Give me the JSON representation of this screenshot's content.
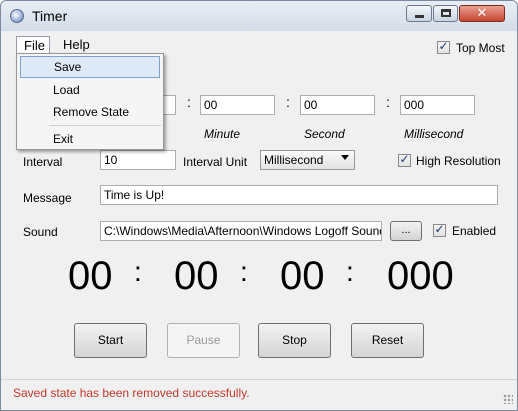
{
  "window": {
    "title": "Timer"
  },
  "menu": {
    "file": "File",
    "help": "Help",
    "file_items": [
      "Save",
      "Load",
      "Remove State",
      "Exit"
    ]
  },
  "top_most": {
    "label": "Top Most",
    "checked": true
  },
  "time_fields": {
    "minute_value": "00",
    "second_value": "00",
    "millisecond_value": "000",
    "minute_label": "Minute",
    "second_label": "Second",
    "millisecond_label": "Millisecond",
    "separator": ":"
  },
  "interval": {
    "label": "Interval",
    "value": "10"
  },
  "interval_unit": {
    "label": "Interval Unit",
    "selected": "Millisecond"
  },
  "high_resolution": {
    "label": "High Resolution",
    "checked": true
  },
  "message": {
    "label": "Message",
    "value": "Time is Up!"
  },
  "sound": {
    "label": "Sound",
    "path": "C:\\Windows\\Media\\Afternoon\\Windows Logoff Sound.wav",
    "browse_label": "...",
    "enabled_label": "Enabled",
    "enabled_checked": true
  },
  "display": {
    "hours": "00",
    "minutes": "00",
    "seconds": "00",
    "milliseconds": "000",
    "separator": ":"
  },
  "buttons": {
    "start": "Start",
    "pause": "Pause",
    "stop": "Stop",
    "reset": "Reset"
  },
  "status": {
    "message": "Saved state has been removed successfully."
  },
  "icons": {
    "app": "timer-app-icon",
    "minimize": "minimize-icon",
    "maximize": "maximize-icon",
    "close": "close-icon",
    "grip": "resize-grip-icon",
    "check": "checkmark-icon"
  },
  "colors": {
    "status_text": "#c0392b",
    "menu_highlight": "#dfeaf8"
  }
}
